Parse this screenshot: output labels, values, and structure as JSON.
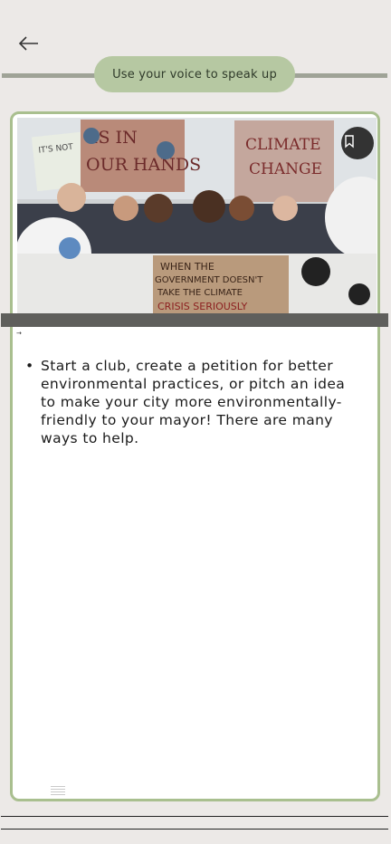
{
  "header": {
    "back_icon": "arrow-left-icon",
    "pill_label": "Use your voice to speak up"
  },
  "card": {
    "bookmark_icon": "bookmark-icon",
    "image_sign_text": [
      "IT'S NOT",
      "IS IN",
      "OUR HANDS",
      "CLIMATE",
      "CHANGE",
      "WHEN THE",
      "GOVERNMENT DOESN'T",
      "TAKE THE CLIMATE",
      "CRISIS SERIOUSLY"
    ],
    "small_mark": "→",
    "bullets": [
      "Start a club, create a petition for better environmental practices, or pitch an idea to make your city more environmentally-friendly to your mayor! There are many ways to help."
    ]
  },
  "colors": {
    "pill": "#b6c8a2",
    "card_border": "#a9bf8f",
    "background": "#ece9e7"
  }
}
